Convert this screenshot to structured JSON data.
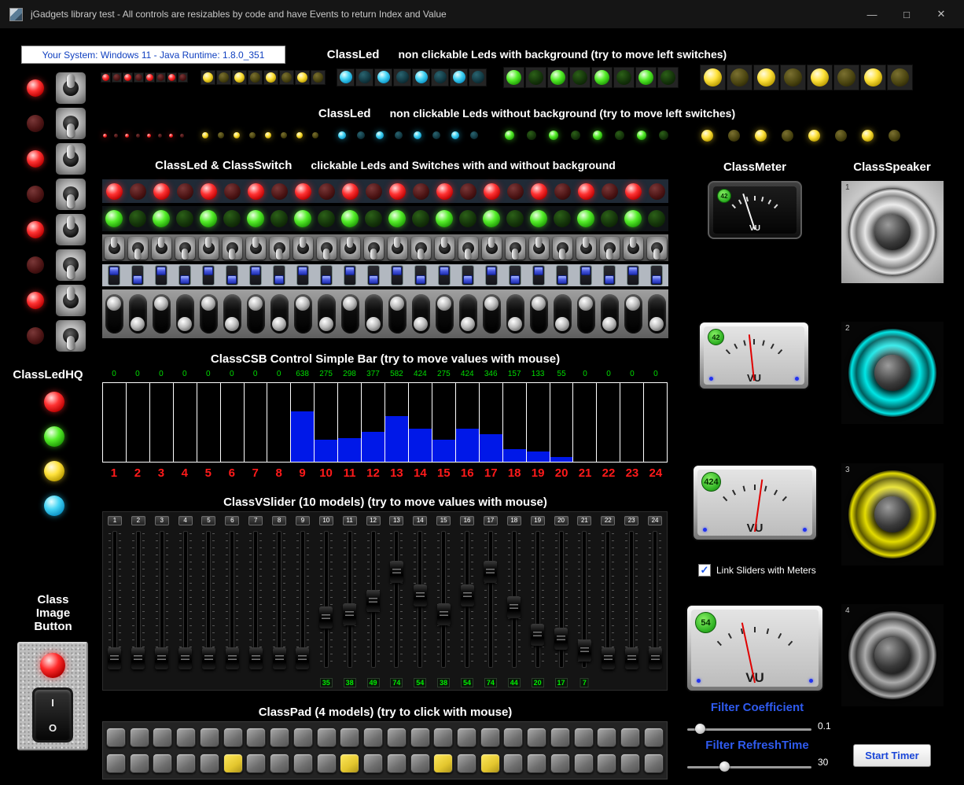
{
  "window": {
    "title": "jGadgets library test - All controls are resizables by code and have Events to return Index and Value",
    "minimize": "—",
    "maximize": "□",
    "close": "✕"
  },
  "sysinfo": "Your System: Windows 11  -  Java Runtime: 1.8.0_351",
  "titles": {
    "led_bg_strong": "ClassLed",
    "led_bg_rest": "non clickable Leds with background (try to move left switches)",
    "led_nobg_strong": "ClassLed",
    "led_nobg_rest": "non clickable Leds without background (try to move left switches)",
    "led_switch_strong": "ClassLed & ClassSwitch",
    "led_switch_rest": "clickable Leds and Switches with and without background",
    "csb": "ClassCSB Control Simple Bar (try to move values with mouse)",
    "vslider": "ClassVSlider (10 models) (try to move values with mouse)",
    "pad": "ClassPad (4 models) (try to click with mouse)",
    "meter": "ClassMeter",
    "speaker": "ClassSpeaker",
    "ledhq": "ClassLedHQ",
    "image_button": [
      "Class",
      "Image",
      "Button"
    ]
  },
  "led_colors": {
    "red": {
      "on": [
        "#ffd8d8",
        "#ff3232",
        "#b80000",
        "#3c0000"
      ],
      "off": [
        "#7a3838",
        "#4c1414",
        "#1c0404"
      ]
    },
    "yellow": {
      "on": [
        "#fffbe0",
        "#ffe23c",
        "#b89a00",
        "#4a3e00"
      ],
      "off": [
        "#7a7030",
        "#4a4410",
        "#1c1800"
      ]
    },
    "cyan": {
      "on": [
        "#e6ffff",
        "#44d4f4",
        "#0b91c4",
        "#003848"
      ],
      "off": [
        "#2a6470",
        "#123a44",
        "#041418"
      ]
    },
    "green": {
      "on": [
        "#eaffe2",
        "#55ee2a",
        "#1f9a06",
        "#0a3a00"
      ],
      "off": [
        "#2c6018",
        "#14340a",
        "#061400"
      ]
    }
  },
  "glow": {
    "red": "rgba(255,40,40,0.65)",
    "yellow": "rgba(255,220,40,0.6)",
    "cyan": "rgba(40,210,255,0.6)",
    "green": "rgba(90,255,40,0.6)"
  },
  "led_rows": {
    "colors": [
      "red",
      "yellow",
      "cyan",
      "green",
      "yellow"
    ],
    "pattern": [
      1,
      0,
      1,
      0,
      1,
      0,
      1,
      0
    ]
  },
  "strips": {
    "led_on": [
      1,
      0,
      1,
      0,
      1,
      0,
      1,
      0,
      1,
      0,
      1,
      0,
      1,
      0,
      1,
      0,
      1,
      0,
      1,
      0,
      1,
      0,
      1,
      0
    ],
    "switch_up": [
      1,
      0,
      1,
      0,
      1,
      0,
      1,
      0,
      1,
      0,
      1,
      0,
      1,
      0,
      1,
      0,
      1,
      0,
      1,
      0,
      1,
      0,
      1,
      0
    ]
  },
  "left_panel": {
    "led_on": [
      1,
      0,
      1,
      0,
      1,
      0,
      1,
      0
    ],
    "switch_up": [
      1,
      0,
      1,
      0,
      1,
      0,
      1,
      0
    ]
  },
  "ledhq_colors": [
    "red",
    "green",
    "yellow",
    "cyan"
  ],
  "chart_data": {
    "type": "bar",
    "title": "ClassCSB Control Simple Bar (try to move values with mouse)",
    "categories": [
      "1",
      "2",
      "3",
      "4",
      "5",
      "6",
      "7",
      "8",
      "9",
      "10",
      "11",
      "12",
      "13",
      "14",
      "15",
      "16",
      "17",
      "18",
      "19",
      "20",
      "21",
      "22",
      "23",
      "24"
    ],
    "values": [
      0,
      0,
      0,
      0,
      0,
      0,
      0,
      0,
      638,
      275,
      298,
      377,
      582,
      424,
      275,
      424,
      346,
      157,
      133,
      55,
      0,
      0,
      0,
      0
    ],
    "ylim": [
      0,
      1000
    ],
    "grid": true,
    "bar_color": "#0018e8",
    "value_label_color": "#00dd00",
    "category_color": "#ff1a1a"
  },
  "vsliders": {
    "labels": [
      "1",
      "2",
      "3",
      "4",
      "5",
      "6",
      "7",
      "8",
      "9",
      "10",
      "11",
      "12",
      "13",
      "14",
      "15",
      "16",
      "17",
      "18",
      "19",
      "20",
      "21",
      "22",
      "23",
      "24"
    ],
    "values": [
      0,
      0,
      0,
      0,
      0,
      0,
      0,
      0,
      0,
      35,
      38,
      49,
      74,
      54,
      38,
      54,
      74,
      44,
      20,
      17,
      7,
      0,
      0,
      0
    ],
    "labeled": [
      10,
      11,
      12,
      13,
      14,
      15,
      16,
      17,
      18,
      19,
      20,
      21
    ]
  },
  "pads": {
    "rows": 2,
    "cols": 24,
    "lit_cells": [
      [],
      [
        6,
        11,
        15,
        17
      ]
    ],
    "lit_color": "#ecd23c"
  },
  "meters": [
    {
      "value": "42",
      "vu": "VU",
      "style": "dark",
      "needle_deg": -18
    },
    {
      "value": "42",
      "vu": "VU",
      "style": "light",
      "needle_deg": -6
    },
    {
      "value": "424",
      "vu": "VU",
      "style": "light",
      "needle_deg": 8
    },
    {
      "value": "54",
      "vu": "VU",
      "style": "light",
      "needle_deg": -12
    }
  ],
  "speakers": [
    {
      "label": "1",
      "body": "light",
      "c1": "#e6e6e6",
      "c2": "#7d7d7d"
    },
    {
      "label": "2",
      "body": "dark",
      "c1": "#00e6e6",
      "c2": "#005c5c"
    },
    {
      "label": "3",
      "body": "dark",
      "c1": "#e4dc00",
      "c2": "#5c5800"
    },
    {
      "label": "4",
      "body": "dark",
      "c1": "#ababab",
      "c2": "#3f3f3f"
    }
  ],
  "controls": {
    "link_label": "Link Sliders with Meters",
    "link_checked": true,
    "check_glyph": "✓",
    "filter_coeff_label": "Filter Coefficient",
    "filter_coeff_value": "0.1",
    "filter_refresh_label": "Filter RefreshTime",
    "filter_refresh_value": "30",
    "start_button": "Start Timer"
  },
  "image_button": {
    "on_mark": "I",
    "off_mark": "O"
  }
}
